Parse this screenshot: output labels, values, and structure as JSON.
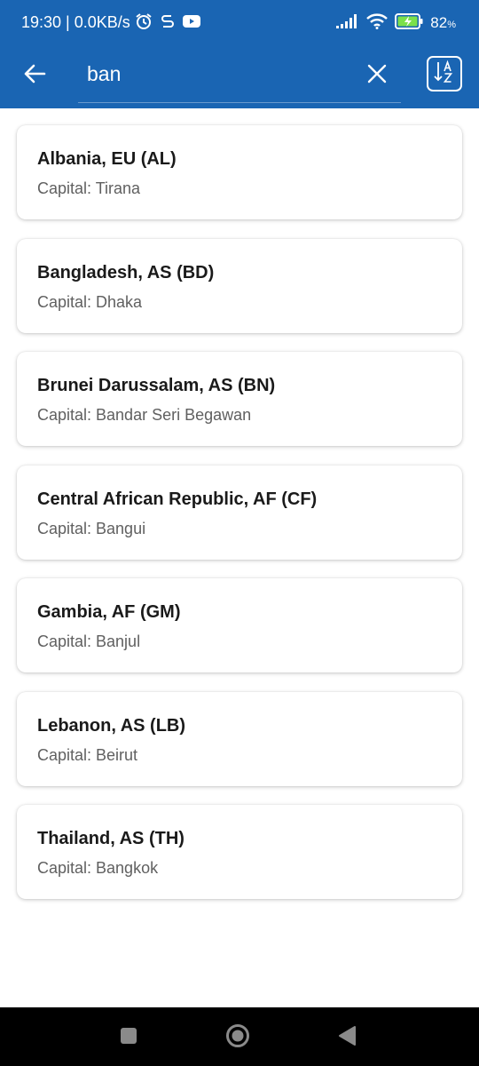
{
  "status_bar": {
    "time": "19:30 | 0.0KB/s",
    "battery": "82",
    "battery_unit": "%",
    "icons": [
      "alarm-icon",
      "sync-icon",
      "youtube-icon",
      "signal-icon",
      "wifi-icon",
      "battery-charging-icon"
    ]
  },
  "search": {
    "value": "ban",
    "placeholder": "Search"
  },
  "colors": {
    "appbar": "#1a65b3",
    "card_title": "#1a1a1a",
    "card_subtitle": "#606060",
    "navbar": "#000000"
  },
  "countries": [
    {
      "title": "Albania, EU (AL)",
      "capital": "Capital: Tirana"
    },
    {
      "title": "Bangladesh, AS (BD)",
      "capital": "Capital: Dhaka"
    },
    {
      "title": "Brunei Darussalam, AS (BN)",
      "capital": "Capital: Bandar Seri Begawan"
    },
    {
      "title": "Central African Republic, AF (CF)",
      "capital": "Capital: Bangui"
    },
    {
      "title": "Gambia, AF (GM)",
      "capital": "Capital: Banjul"
    },
    {
      "title": "Lebanon, AS (LB)",
      "capital": "Capital: Beirut"
    },
    {
      "title": "Thailand, AS (TH)",
      "capital": "Capital: Bangkok"
    }
  ],
  "nav": [
    "recents-icon",
    "home-icon",
    "back-triangle-icon"
  ]
}
